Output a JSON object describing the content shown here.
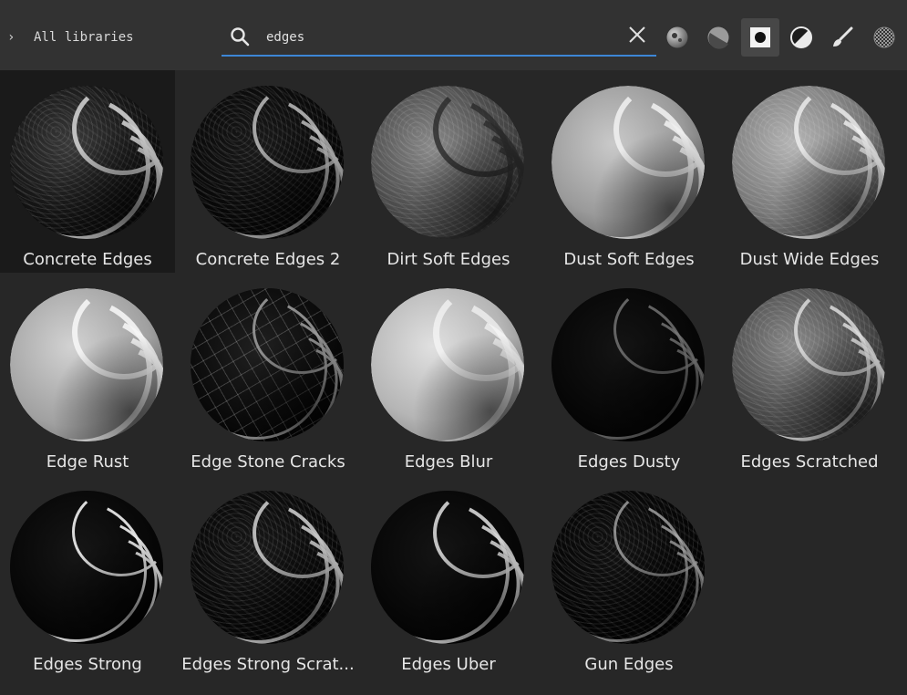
{
  "header": {
    "library_selector": {
      "chevron": "›",
      "label": "All libraries"
    },
    "search": {
      "value": "edges",
      "placeholder": ""
    },
    "filter_icons": [
      "grunge-sphere-icon",
      "shaded-sphere-icon",
      "mask-icon",
      "contrast-icon",
      "brush-icon",
      "pattern-icon"
    ],
    "active_filter": "mask-icon"
  },
  "materials": [
    {
      "label": "Concrete Edges",
      "style": "concrete",
      "selected": true
    },
    {
      "label": "Concrete Edges 2",
      "style": "dark-speckle"
    },
    {
      "label": "Dirt Soft Edges",
      "style": "dirt"
    },
    {
      "label": "Dust Soft Edges",
      "style": "dust"
    },
    {
      "label": "Dust Wide Edges",
      "style": "dust-wide"
    },
    {
      "label": "Edge Rust",
      "style": "rust"
    },
    {
      "label": "Edge Stone Cracks",
      "style": "cracks"
    },
    {
      "label": "Edges Blur",
      "style": "blur"
    },
    {
      "label": "Edges Dusty",
      "style": "dusty"
    },
    {
      "label": "Edges Scratched",
      "style": "scratched"
    },
    {
      "label": "Edges Strong",
      "style": "strong"
    },
    {
      "label": "Edges Strong Scrat...",
      "style": "strong-scratch"
    },
    {
      "label": "Edges Uber",
      "style": "uber"
    },
    {
      "label": "Gun Edges",
      "style": "gun"
    }
  ],
  "colors": {
    "accent": "#3d86d6",
    "panel": "#323232",
    "background": "#272727"
  }
}
